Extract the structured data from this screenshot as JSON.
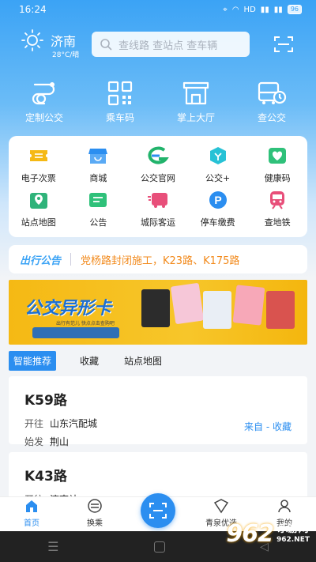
{
  "status": {
    "time": "16:24",
    "battery": "96"
  },
  "weather": {
    "city": "济南",
    "temp": "28°C/晴"
  },
  "search": {
    "placeholder": "查线路 查站点 查车辆"
  },
  "big_nav": [
    {
      "label": "定制公交",
      "icon": "custom-bus-icon"
    },
    {
      "label": "乘车码",
      "icon": "qr-code-icon"
    },
    {
      "label": "掌上大厅",
      "icon": "hall-icon"
    },
    {
      "label": "查公交",
      "icon": "bus-time-icon"
    }
  ],
  "grid": [
    {
      "label": "电子次票",
      "icon": "ticket-icon",
      "color": "#f5b914"
    },
    {
      "label": "商城",
      "icon": "shop-icon",
      "color": "#2b8ef0"
    },
    {
      "label": "公交官网",
      "icon": "website-icon",
      "color": "#21b36b"
    },
    {
      "label": "公交+",
      "icon": "cube-icon",
      "color": "#27c2d6"
    },
    {
      "label": "健康码",
      "icon": "health-code-icon",
      "color": "#2fc17a"
    },
    {
      "label": "站点地图",
      "icon": "map-icon",
      "color": "#2fb37a"
    },
    {
      "label": "公告",
      "icon": "notice-icon",
      "color": "#2fc17a"
    },
    {
      "label": "城际客运",
      "icon": "intercity-icon",
      "color": "#e84f7a"
    },
    {
      "label": "停车缴费",
      "icon": "parking-icon",
      "color": "#2b8ef0"
    },
    {
      "label": "查地铁",
      "icon": "metro-icon",
      "color": "#e84f7a"
    }
  ],
  "notice": {
    "brand": "出行公告",
    "text": "党杨路封闭施工，K23路、K175路"
  },
  "banner": {
    "title": "公交异形卡",
    "sub": "出行有范儿  快点点击查购吧"
  },
  "tabs": [
    "智能推荐",
    "收藏",
    "站点地图"
  ],
  "routes": [
    {
      "name": "K59路",
      "to_label": "开往",
      "to": "山东汽配城",
      "from_label": "始发",
      "from": "荆山",
      "source": "来自 - 收藏"
    },
    {
      "name": "K43路",
      "to_label": "开往",
      "to": "济南站"
    }
  ],
  "bottom_tabs": [
    {
      "label": "首页",
      "icon": "home-icon"
    },
    {
      "label": "换乘",
      "icon": "transfer-icon"
    },
    {
      "label": "",
      "icon": "scan-icon"
    },
    {
      "label": "青泉优选",
      "icon": "mall-icon"
    },
    {
      "label": "我的",
      "icon": "profile-icon"
    }
  ],
  "watermark": {
    "num": "962",
    "site": "乐游网",
    "url": "962.NET"
  }
}
